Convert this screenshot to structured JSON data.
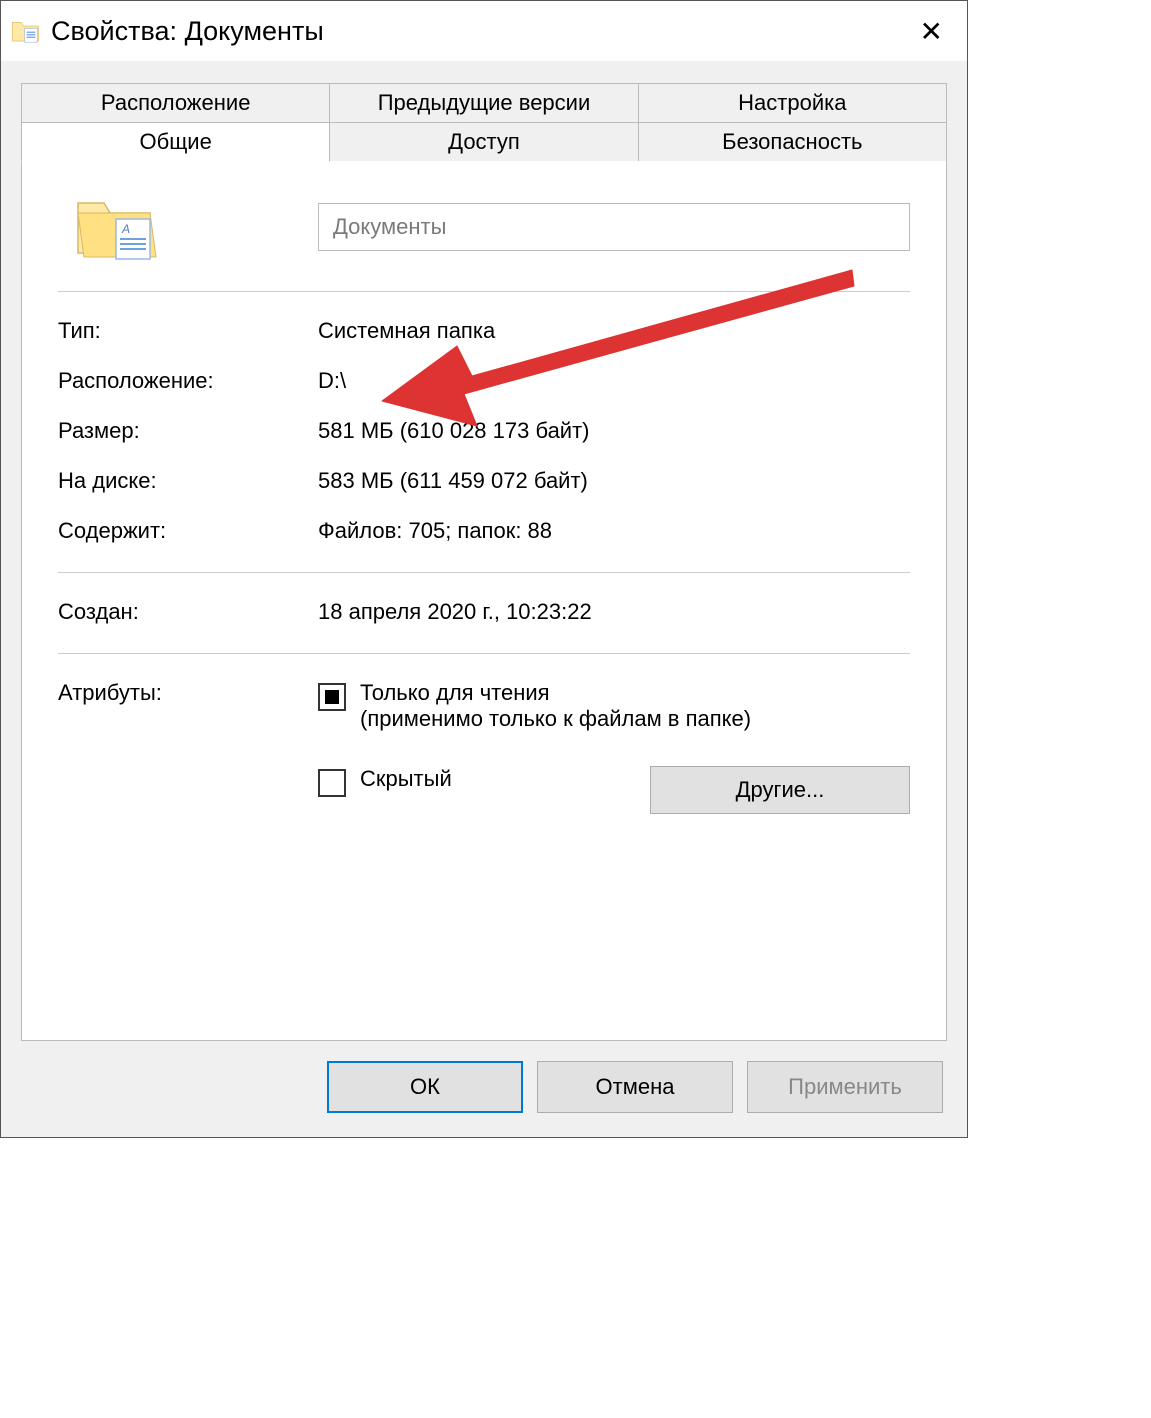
{
  "title": "Свойства: Документы",
  "tabs": {
    "row1": [
      "Расположение",
      "Предыдущие версии",
      "Настройка"
    ],
    "row2": [
      "Общие",
      "Доступ",
      "Безопасность"
    ],
    "active": "Общие"
  },
  "general": {
    "name": "Документы",
    "type_label": "Тип:",
    "type_value": "Системная папка",
    "location_label": "Расположение:",
    "location_value": "D:\\",
    "size_label": "Размер:",
    "size_value": "581 МБ (610 028 173 байт)",
    "ondisk_label": "На диске:",
    "ondisk_value": "583 МБ (611 459 072 байт)",
    "contains_label": "Содержит:",
    "contains_value": "Файлов: 705; папок: 88",
    "created_label": "Создан:",
    "created_value": "18 апреля 2020 г., 10:23:22",
    "attributes_label": "Атрибуты:",
    "readonly_label": "Только для чтения",
    "readonly_sub": "(применимо только к файлам в папке)",
    "hidden_label": "Скрытый",
    "other_button": "Другие..."
  },
  "buttons": {
    "ok": "ОК",
    "cancel": "Отмена",
    "apply": "Применить"
  }
}
